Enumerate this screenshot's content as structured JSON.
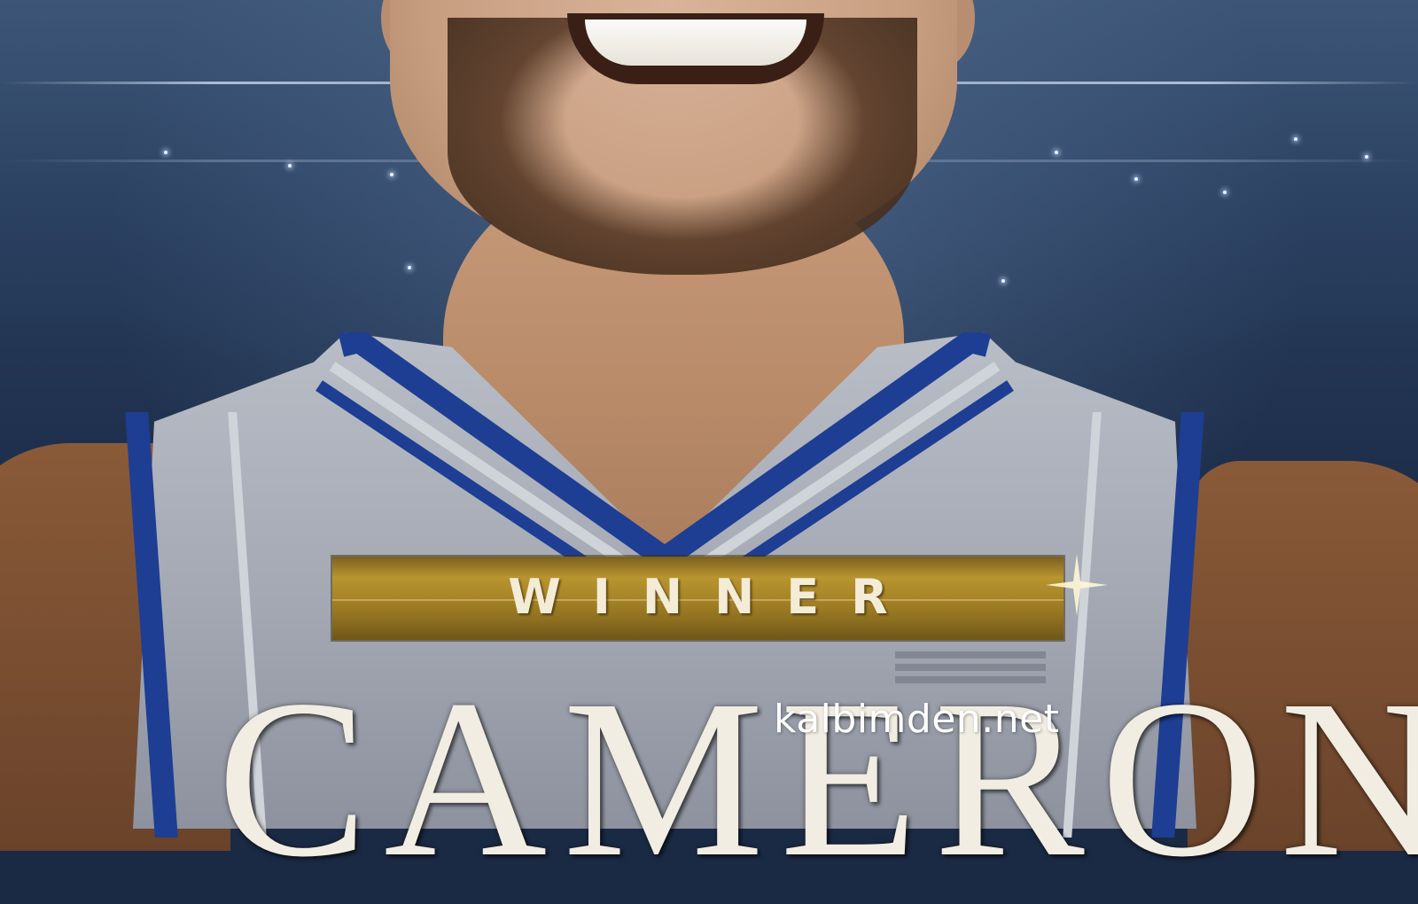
{
  "poster": {
    "badge_text": "WINNER",
    "player_name": "CAMERON",
    "watermark": "kalbimden.net"
  },
  "colors": {
    "background": "#1b2a44",
    "jersey": "#b9bdc6",
    "jersey_trim": "#1e3e93",
    "banner_gold": "#a78427",
    "text_light": "#f1ede2"
  }
}
